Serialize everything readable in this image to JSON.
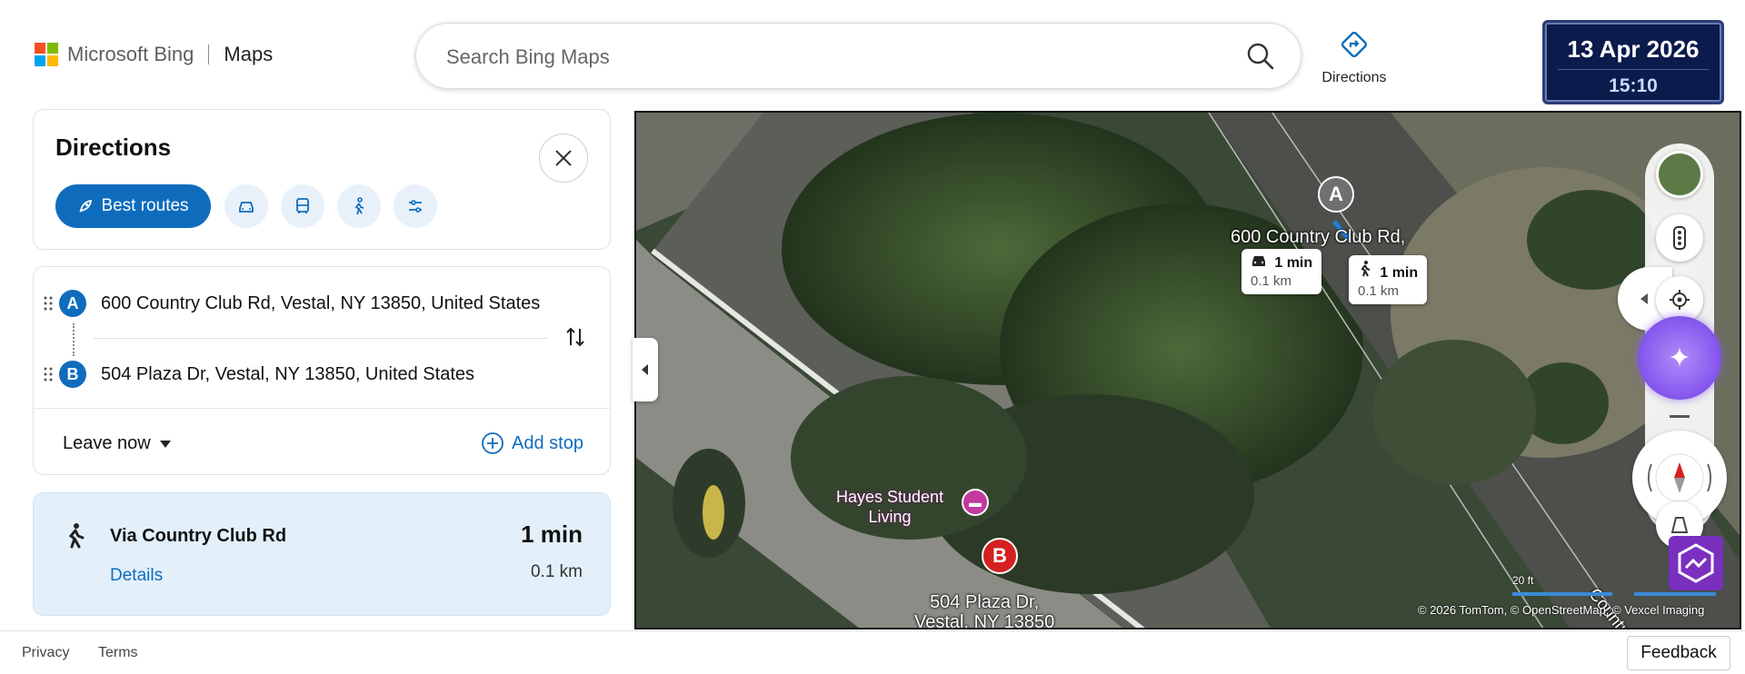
{
  "header": {
    "brand": "Microsoft Bing",
    "product": "Maps",
    "search_placeholder": "Search Bing Maps",
    "directions_label": "Directions",
    "date": "13 Apr 2026",
    "time": "15:10"
  },
  "directions": {
    "title": "Directions",
    "best_routes_label": "Best routes",
    "modes": [
      "drive",
      "transit",
      "walk",
      "options"
    ],
    "waypoints": [
      {
        "letter": "A",
        "address": "600 Country Club Rd, Vestal, NY 13850, United States"
      },
      {
        "letter": "B",
        "address": "504 Plaza Dr, Vestal, NY 13850, United States"
      }
    ],
    "leave_now": "Leave now",
    "add_stop": "Add stop"
  },
  "route": {
    "name": "Via Country Club Rd",
    "time": "1 min",
    "distance": "0.1 km",
    "details": "Details"
  },
  "map": {
    "pin_a": "A",
    "pin_b": "B",
    "label_a": "600 Country Club Rd,",
    "label_b_line1": "504 Plaza Dr,",
    "label_b_line2": "Vestal, NY 13850",
    "poi_line1": "Hayes Student",
    "poi_line2": "Living",
    "road_label": "Country Club Rd",
    "drive_callout": {
      "time": "1 min",
      "distance": "0.1 km"
    },
    "walk_callout": {
      "time": "1 min",
      "distance": "0.1 km"
    },
    "scale": "20 ft",
    "attribution": "© 2026 TomTom, © OpenStreetMap, © Vexcel Imaging"
  },
  "footer": {
    "privacy": "Privacy",
    "terms": "Terms",
    "feedback": "Feedback"
  },
  "colors": {
    "accent": "#0f6cbd",
    "route_card_bg": "#e3f0fa",
    "pin_b": "#d42020",
    "copilot": "#8a5cf0"
  }
}
